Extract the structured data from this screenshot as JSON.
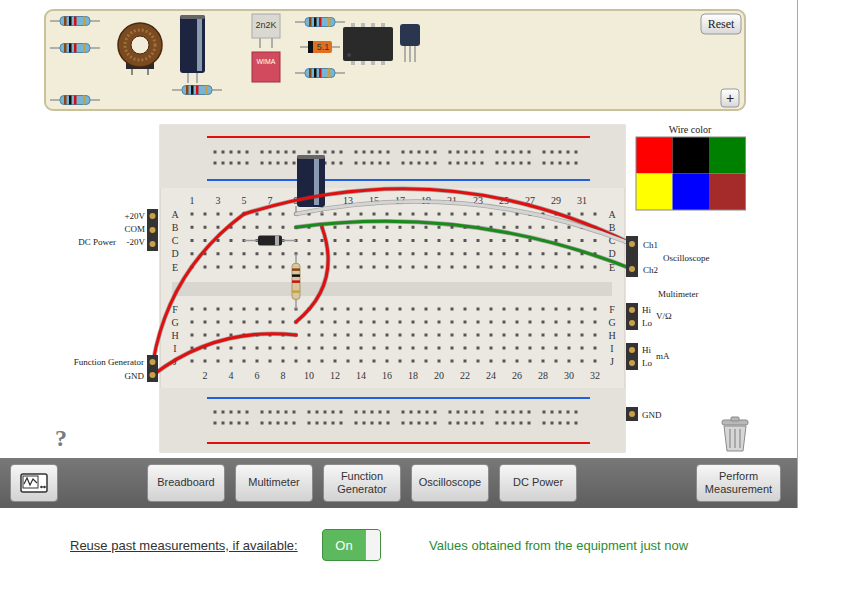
{
  "tray": {
    "parts": [
      {
        "kind": "resistor"
      },
      {
        "kind": "resistor"
      },
      {
        "kind": "resistor"
      },
      {
        "kind": "inductor"
      },
      {
        "kind": "electrolytic"
      },
      {
        "kind": "resistor"
      },
      {
        "kind": "film-capacitor",
        "label": "2n2K"
      },
      {
        "kind": "box-capacitor",
        "label": "WIMA"
      },
      {
        "kind": "resistor"
      },
      {
        "kind": "zener",
        "label": "5.1"
      },
      {
        "kind": "resistor"
      },
      {
        "kind": "ic"
      },
      {
        "kind": "transistor"
      }
    ],
    "reset": "Reset",
    "add": "+"
  },
  "palette": {
    "title": "Wire color",
    "colors": [
      "#ff0000",
      "#000000",
      "#008000",
      "#ffff00",
      "#0000ff",
      "#a52a2a"
    ]
  },
  "breadboard": {
    "columns_top": [
      "1",
      "3",
      "5",
      "7",
      "9",
      "13",
      "15",
      "17",
      "19",
      "21",
      "23",
      "25",
      "27",
      "29",
      "31"
    ],
    "columns_bottom": [
      "2",
      "4",
      "6",
      "8",
      "10",
      "12",
      "14",
      "16",
      "18",
      "20",
      "22",
      "24",
      "26",
      "28",
      "30",
      "32"
    ],
    "rows_top": [
      "A",
      "B",
      "C",
      "D",
      "E"
    ],
    "rows_bottom": [
      "F",
      "G",
      "H",
      "I",
      "J"
    ]
  },
  "placed_parts": [
    {
      "kind": "electrolytic",
      "from": "A9",
      "to": "A11"
    },
    {
      "kind": "diode",
      "from": "C5",
      "to": "C9"
    },
    {
      "kind": "resistor",
      "from": "D9",
      "to": "F9"
    }
  ],
  "wires": [
    {
      "color": "#e01010",
      "from": "fg.out",
      "to": "A5"
    },
    {
      "color": "#e01010",
      "from": "A5",
      "to": "scope.ch1"
    },
    {
      "color": "#d4d4d4",
      "from": "A9",
      "to": "scope.ch1"
    },
    {
      "color": "#1a8a1a",
      "from": "B9",
      "to": "scope.ch2"
    },
    {
      "color": "#e01010",
      "from": "B11",
      "to": "G9"
    },
    {
      "color": "#e01010",
      "from": "fg.gnd",
      "to": "H9"
    }
  ],
  "dc_power": {
    "title": "DC Power",
    "terminals": [
      "+20V",
      "COM",
      "-20V"
    ]
  },
  "function_generator": {
    "title": "Function Generator",
    "ground": "GND"
  },
  "oscilloscope": {
    "title": "Oscilloscope",
    "channels": [
      "Ch1",
      "Ch2"
    ]
  },
  "multimeter": {
    "title": "Multimeter",
    "inputs": [
      {
        "hi": "Hi",
        "lo": "Lo",
        "unit": "V/Ω"
      },
      {
        "hi": "Hi",
        "lo": "Lo",
        "unit": "mA"
      }
    ]
  },
  "ground": "GND",
  "help": "?",
  "toolbar": {
    "buttons": [
      "Breadboard",
      "Multimeter",
      "Function Generator",
      "Oscilloscope",
      "DC Power"
    ],
    "action": "Perform Measurement"
  },
  "reuse": {
    "label": "Reuse past measurements, if available:",
    "toggle": "On",
    "on": true
  },
  "status": "Values obtained from the equipment just now"
}
